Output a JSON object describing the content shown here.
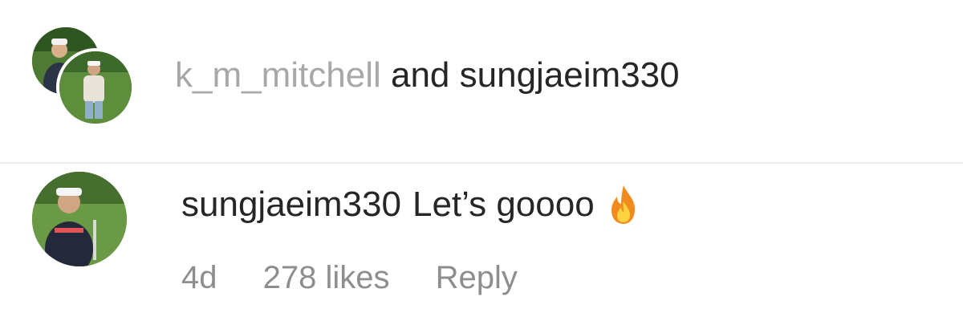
{
  "liked_by": {
    "user_1": "k_m_mitchell",
    "conjunction": "and",
    "user_2": "sungjaeim330"
  },
  "comment": {
    "username": "sungjaeim330",
    "text": "Let’s goooo",
    "emoji": "fire-icon",
    "time": "4d",
    "likes": "278 likes",
    "reply_label": "Reply"
  },
  "colors": {
    "primary_text": "#262626",
    "muted_text": "#8e8e8e",
    "light_muted_text": "#a8a8a8",
    "divider": "#ececec"
  }
}
